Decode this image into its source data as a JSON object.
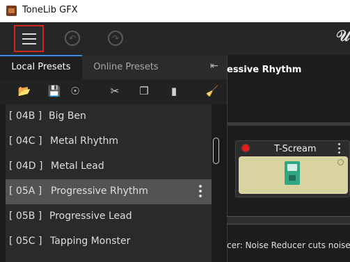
{
  "window": {
    "title": "ToneLib GFX"
  },
  "toolbar": {
    "menu": "hamburger-menu",
    "undo": "undo",
    "redo": "redo"
  },
  "tabs": [
    {
      "label": "Local Presets",
      "active": true
    },
    {
      "label": "Online Presets",
      "active": false
    }
  ],
  "preset_actions": [
    "open-folder",
    "save",
    "add-online",
    "cut",
    "copy",
    "paste",
    "clean"
  ],
  "presets": [
    {
      "code": "[ 04B ]",
      "name": "Big Ben"
    },
    {
      "code": "[ 04C ]",
      "name": "Metal Rhythm"
    },
    {
      "code": "[ 04D ]",
      "name": "Metal Lead"
    },
    {
      "code": "[ 05A ]",
      "name": "Progressive Rhythm",
      "selected": true
    },
    {
      "code": "[ 05B ]",
      "name": "Progressive Lead"
    },
    {
      "code": "[ 05C ]",
      "name": "Tapping Monster"
    }
  ],
  "current_preset": {
    "title": "essive Rhythm"
  },
  "pedal": {
    "name": "T-Scream",
    "enabled": true
  },
  "status": {
    "text": "cer:  Noise Reducer cuts noise"
  },
  "colors": {
    "accent": "#3a8ee6",
    "highlight_border": "#d32424",
    "led": "#e31c1c",
    "pedal": "#d8d3a0"
  }
}
